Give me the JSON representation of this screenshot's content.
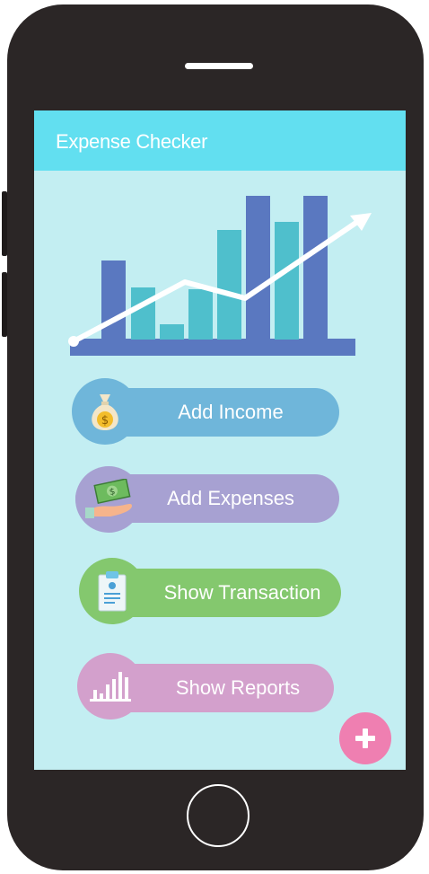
{
  "app": {
    "title": "Expense Checker"
  },
  "menu": [
    {
      "label": "Add Income",
      "icon": "money-bag-icon",
      "color": "#6fb6da"
    },
    {
      "label": "Add Expenses",
      "icon": "hand-cash-icon",
      "color": "#a7a1d2"
    },
    {
      "label": "Show Transaction",
      "icon": "clipboard-icon",
      "color": "#84c86e"
    },
    {
      "label": "Show Reports",
      "icon": "bar-chart-icon",
      "color": "#d3a0cc"
    }
  ],
  "fab": {
    "icon": "plus-icon",
    "color": "#ef7fb1"
  },
  "colors": {
    "appbar": "#62dff0",
    "screen": "#c3eef2",
    "phone_body": "#2b2626"
  }
}
